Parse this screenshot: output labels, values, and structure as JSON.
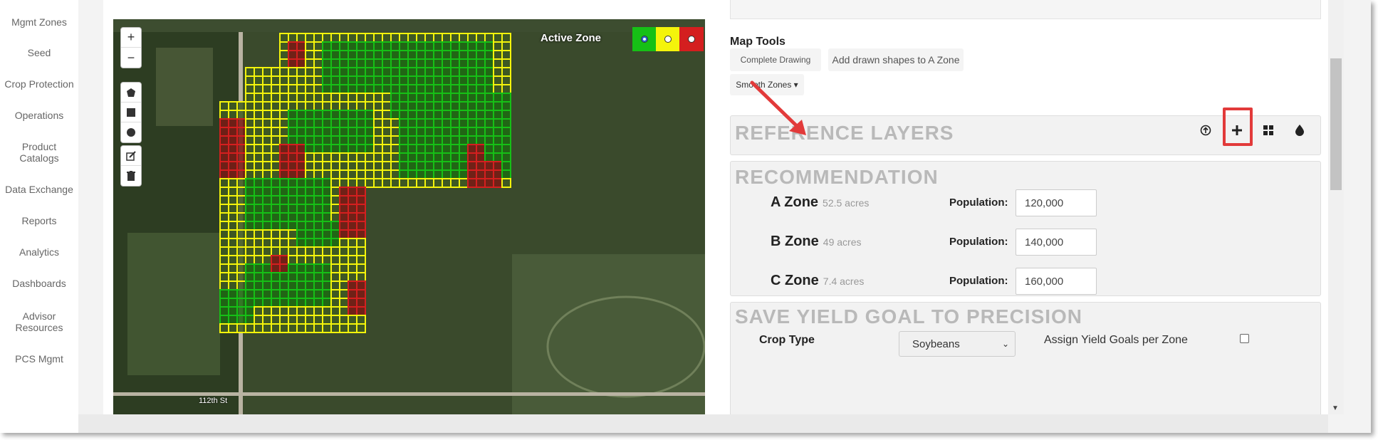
{
  "nav": {
    "items": [
      "Mgmt Zones",
      "Seed",
      "Crop Protection",
      "Operations",
      "Product\nCatalogs",
      "Data Exchange",
      "Reports",
      "Analytics",
      "Dashboards",
      "Advisor\nResources",
      "PCS Mgmt"
    ]
  },
  "map": {
    "active_zone_label": "Active Zone",
    "zone_colors": [
      "#16c016",
      "#f4f40b",
      "#d41f1f"
    ],
    "selected_zone": 0,
    "road_label": "112th St",
    "controls": {
      "zoom_in": "+",
      "zoom_out": "−"
    }
  },
  "map_tools": {
    "heading": "Map Tools",
    "complete_drawing": "Complete Drawing",
    "add_shapes": "Add drawn shapes to A Zone",
    "smooth_zones": "Smooth Zones ▾"
  },
  "reference_layers": {
    "title": "REFERENCE LAYERS",
    "icons": [
      "upload-icon",
      "plus-icon",
      "grid-icon",
      "drop-icon"
    ]
  },
  "recommendation": {
    "title": "RECOMMENDATION",
    "zones": [
      {
        "name": "A Zone",
        "acres": "52.5 acres",
        "pop_label": "Population:",
        "population": "120,000"
      },
      {
        "name": "B Zone",
        "acres": "49 acres",
        "pop_label": "Population:",
        "population": "140,000"
      },
      {
        "name": "C Zone",
        "acres": "7.4 acres",
        "pop_label": "Population:",
        "population": "160,000"
      }
    ]
  },
  "yield_goal": {
    "title": "SAVE YIELD GOAL TO PRECISION",
    "crop_type_label": "Crop Type",
    "crop_value": "Soybeans",
    "assign_label": "Assign Yield Goals per Zone"
  },
  "colors": {
    "highlight": "#e23a3a",
    "title_gray": "#b9b9b9"
  }
}
